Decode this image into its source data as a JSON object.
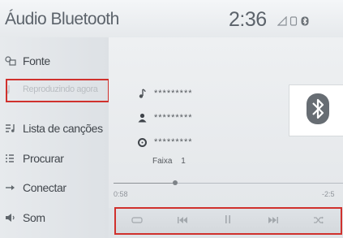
{
  "header": {
    "title": "Áudio Bluetooth",
    "clock": "2:36",
    "status_icons": [
      "signal-icon",
      "phone-icon",
      "bluetooth-status-icon"
    ]
  },
  "sidebar": {
    "items": [
      {
        "label": "Fonte",
        "icon": "source-icon",
        "enabled": true
      },
      {
        "label": "Reproduzindo agora",
        "icon": "now-playing-icon",
        "enabled": false
      },
      {
        "label": "Lista de canções",
        "icon": "song-list-icon",
        "enabled": true
      },
      {
        "label": "Procurar",
        "icon": "browse-icon",
        "enabled": true
      },
      {
        "label": "Conectar",
        "icon": "connect-icon",
        "enabled": true
      },
      {
        "label": "Som",
        "icon": "speaker-icon",
        "enabled": true
      }
    ]
  },
  "now_playing": {
    "song": "*********",
    "artist": "*********",
    "album": "*********",
    "track_label": "Faixa",
    "track_number": "1",
    "elapsed": "0:58",
    "remaining": "-2:5",
    "progress": 0.27
  },
  "controls": {
    "buttons": [
      "repeat-icon",
      "previous-icon",
      "pause-icon",
      "next-icon",
      "shuffle-icon"
    ]
  },
  "colors": {
    "highlight_border": "#d0312d",
    "text": "#41464c",
    "disabled_text": "#b9bdc2"
  }
}
